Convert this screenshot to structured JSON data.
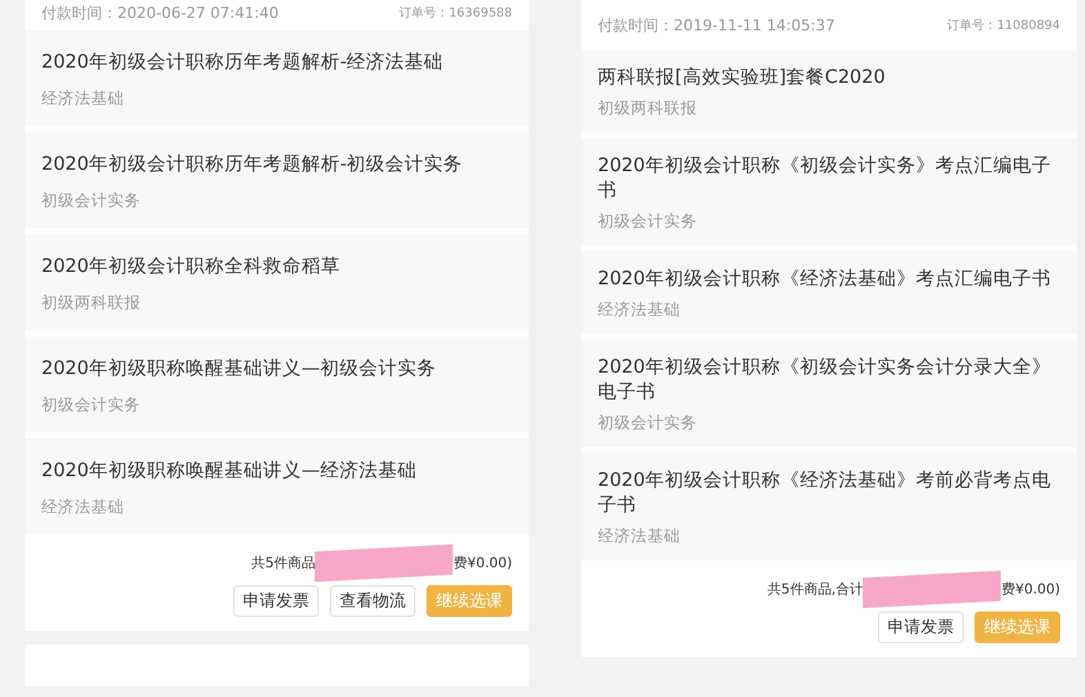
{
  "orders": [
    {
      "paid_label": "付款时间：2020-06-27 07:41:40",
      "order_no": "订单号：16369588",
      "items": [
        {
          "title": "2020年初级会计职称历年考题解析-经济法基础",
          "subject": "经济法基础"
        },
        {
          "title": "2020年初级会计职称历年考题解析-初级会计实务",
          "subject": "初级会计实务"
        },
        {
          "title": "2020年初级会计职称全科救命稻草",
          "subject": "初级两科联报"
        },
        {
          "title": "2020年初级职称唤醒基础讲义—初级会计实务",
          "subject": "初级会计实务"
        },
        {
          "title": "2020年初级职称唤醒基础讲义—经济法基础",
          "subject": "经济法基础"
        }
      ],
      "summary_start": "共5件商品",
      "summary_end": "费¥0.00)",
      "buttons": [
        {
          "label": "申请发票",
          "kind": "plain"
        },
        {
          "label": "查看物流",
          "kind": "plain"
        },
        {
          "label": "继续选课",
          "kind": "primary"
        }
      ]
    },
    {
      "paid_label": "付款时间：2019-11-11 14:05:37",
      "order_no": "订单号：11080894",
      "items": [
        {
          "title": "两科联报[高效实验班]套餐C2020",
          "subject": "初级两科联报"
        },
        {
          "title": "2020年初级会计职称《初级会计实务》考点汇编电子书",
          "subject": "初级会计实务"
        },
        {
          "title": "2020年初级会计职称《经济法基础》考点汇编电子书",
          "subject": "经济法基础"
        },
        {
          "title": "2020年初级会计职称《初级会计实务会计分录大全》电子书",
          "subject": "初级会计实务"
        },
        {
          "title": "2020年初级会计职称《经济法基础》考前必背考点电子书",
          "subject": "经济法基础"
        }
      ],
      "summary_start": "共5件商品,合计",
      "summary_end": "费¥0.00)",
      "buttons": [
        {
          "label": "申请发票",
          "kind": "plain"
        },
        {
          "label": "继续选课",
          "kind": "primary"
        }
      ]
    }
  ]
}
